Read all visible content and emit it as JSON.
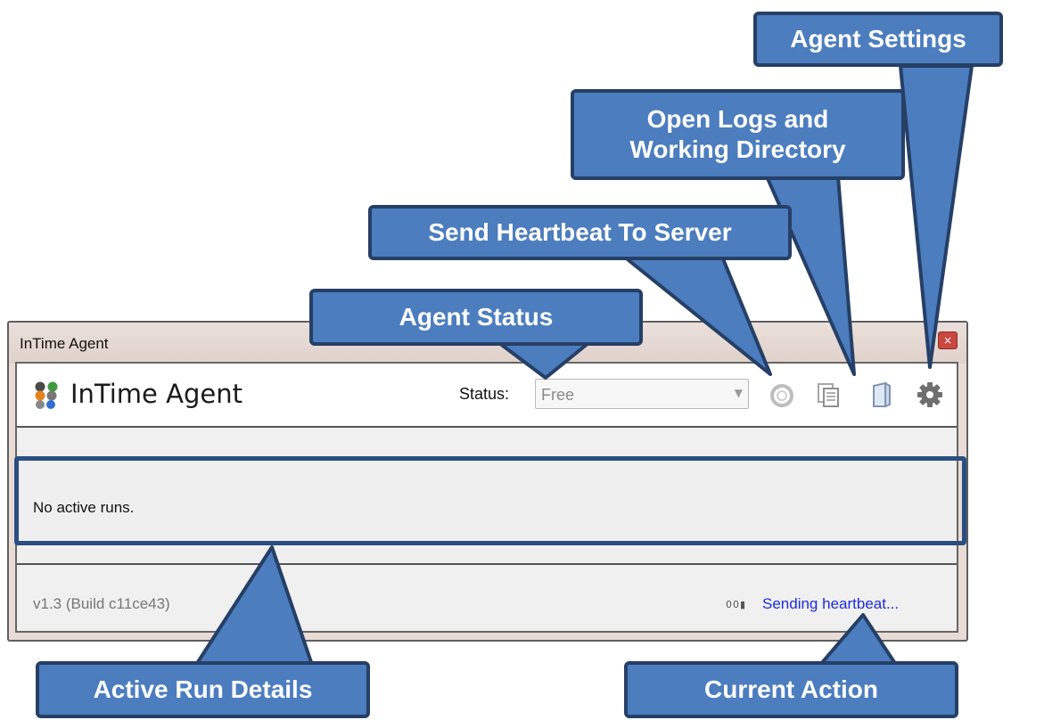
{
  "window": {
    "title": "InTime Agent",
    "close_glyph": "×"
  },
  "header": {
    "logo_icon": "intime-logo-icon",
    "app_title": "InTime Agent",
    "status_label": "Status:",
    "status_value": "Free",
    "tools": [
      {
        "icon": "refresh-heartbeat-icon"
      },
      {
        "icon": "copy-logs-icon"
      },
      {
        "icon": "open-directory-icon"
      },
      {
        "icon": "gear-icon"
      }
    ]
  },
  "runs": {
    "empty_text": "No active runs."
  },
  "footer": {
    "version": "v1.3 (Build c11ce43)",
    "spinner": "00▮",
    "current_action": "Sending heartbeat..."
  },
  "callouts": {
    "agent_settings": "Agent Settings",
    "open_logs": "Open Logs and Working Directory",
    "heartbeat": "Send Heartbeat To Server",
    "agent_status": "Agent Status",
    "active_run_details": "Active Run Details",
    "current_action": "Current Action"
  },
  "colors": {
    "callout_fill": "#4b7dbf",
    "callout_border": "#263f66",
    "action_text": "#1d2bd9"
  }
}
